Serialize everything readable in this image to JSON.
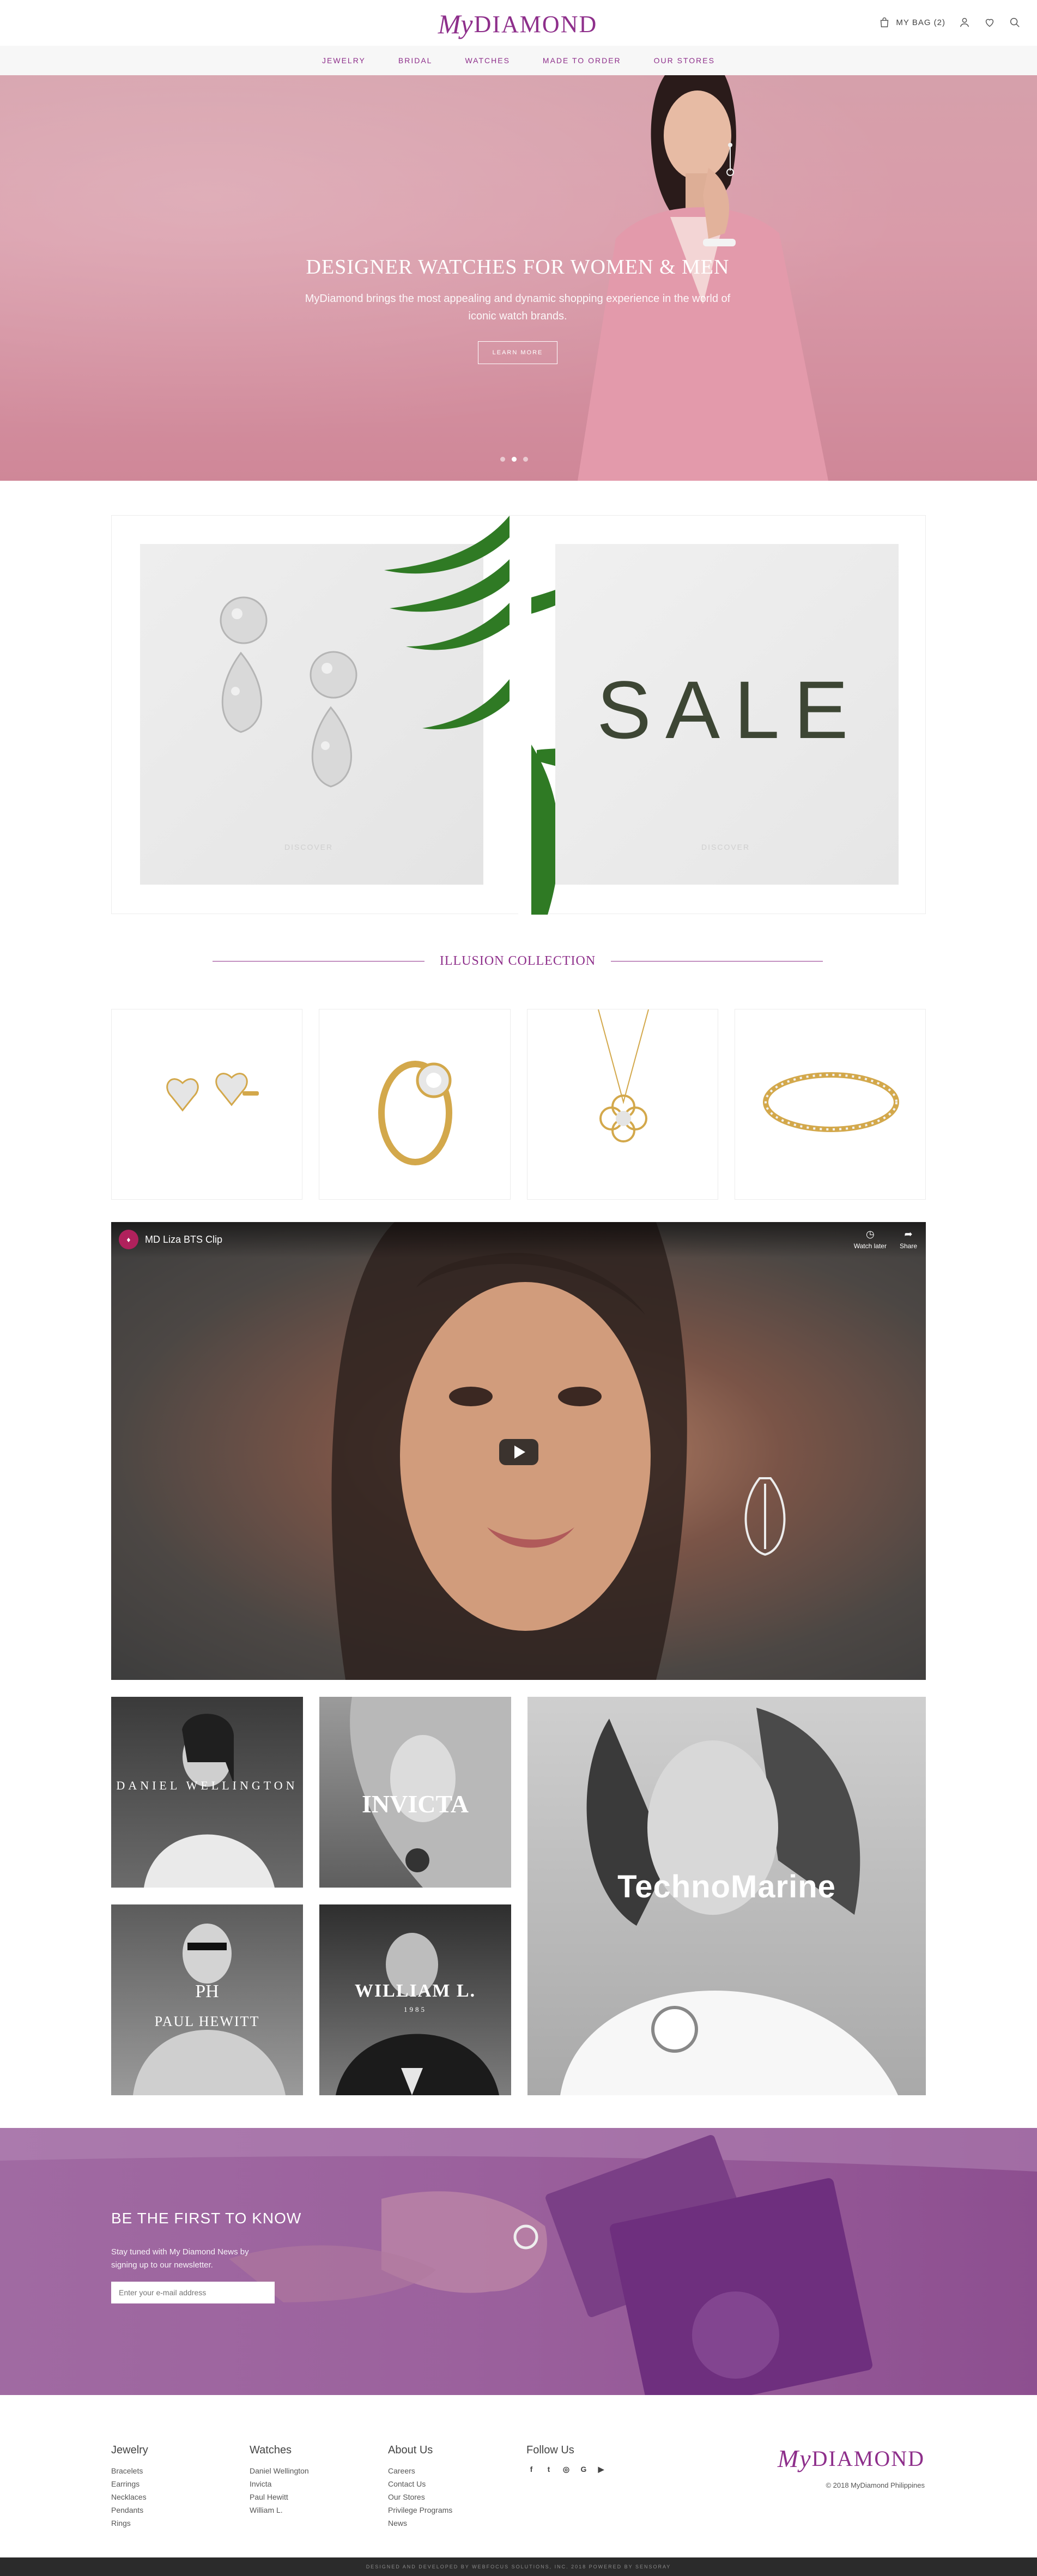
{
  "header": {
    "logo_my": "My",
    "logo_main": "DIAMOND",
    "bag_label": "MY BAG (2)",
    "icons": [
      "bag-icon",
      "user-icon",
      "heart-icon",
      "search-icon"
    ]
  },
  "nav": [
    "JEWELRY",
    "BRIDAL",
    "WATCHES",
    "MADE TO ORDER",
    "OUR STORES"
  ],
  "hero": {
    "title": "DESIGNER WATCHES FOR WOMEN & MEN",
    "subtitle": "MyDiamond brings the most appealing and dynamic shopping experience in the world of iconic watch brands.",
    "button": "LEARN MORE",
    "slides": 3,
    "active_slide": 1
  },
  "promo": {
    "left_discover": "DISCOVER",
    "sale": "SALE",
    "right_discover": "DISCOVER"
  },
  "collection": {
    "heading": "ILLUSION COLLECTION",
    "products": [
      "earrings",
      "ring",
      "necklace",
      "bracelet"
    ]
  },
  "video": {
    "title": "MD Liza BTS Clip",
    "watch_later": "Watch later",
    "share": "Share"
  },
  "brands": [
    {
      "name": "DANIEL WELLINGTON"
    },
    {
      "name": "INVICTA"
    },
    {
      "name": "TechnoMarine"
    },
    {
      "name": "PAUL HEWITT"
    },
    {
      "name": "WILLIAM L.",
      "sub": "1985"
    }
  ],
  "newsletter": {
    "title": "BE THE FIRST TO KNOW",
    "subtitle": "Stay tuned with My Diamond News by signing up to our newsletter.",
    "placeholder": "Enter your e-mail address"
  },
  "footer": {
    "columns": [
      {
        "title": "Jewelry",
        "items": [
          "Bracelets",
          "Earrings",
          "Necklaces",
          "Pendants",
          "Rings"
        ]
      },
      {
        "title": "Watches",
        "items": [
          "Daniel Wellington",
          "Invicta",
          "Paul Hewitt",
          "William L."
        ]
      },
      {
        "title": "About Us",
        "items": [
          "Careers",
          "Contact Us",
          "Our Stores",
          "Privilege Programs",
          "News"
        ]
      }
    ],
    "follow_title": "Follow Us",
    "social": [
      "f",
      "t",
      "ig",
      "G",
      "yt"
    ],
    "logo_my": "My",
    "logo_main": "DIAMOND",
    "copyright": "© 2018 MyDiamond Philippines",
    "bottom_bar": "DESIGNED AND DEVELOPED BY WEBFOCUS SOLUTIONS, INC. 2018 POWERED BY SENSORAY"
  }
}
